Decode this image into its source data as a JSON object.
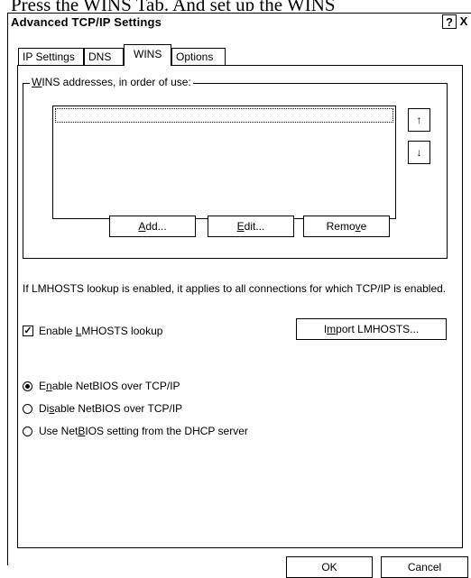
{
  "caption": "Press the WINS Tab. And set up the WINS",
  "dialog": {
    "title": "Advanced TCP/IP Settings",
    "help_label": "?",
    "close_label": "X"
  },
  "tabs": [
    {
      "label": "IP Settings",
      "active": false
    },
    {
      "label": "DNS",
      "active": false
    },
    {
      "label": "WINS",
      "active": true
    },
    {
      "label": "Options",
      "active": false
    }
  ],
  "wins": {
    "group_label_mnemonic": "W",
    "group_label_rest": "INS addresses, in order of use:",
    "addresses": [],
    "move_up_label": "↑",
    "move_down_label": "↓",
    "add_label_mnemonic": "A",
    "add_label_rest": "dd...",
    "edit_label_mnemonic": "E",
    "edit_label_rest": "dit...",
    "remove_label_pre": "Remo",
    "remove_label_mnemonic": "v",
    "remove_label_post": "e"
  },
  "lmhosts": {
    "info": "If LMHOSTS lookup is enabled, it applies to all connections for which TCP/IP is enabled.",
    "checkbox_pre": "Enable ",
    "checkbox_mnemonic": "L",
    "checkbox_post": "MHOSTS lookup",
    "checked": true,
    "import_pre": "I",
    "import_mnemonic": "m",
    "import_post": "port LMHOSTS..."
  },
  "netbios": {
    "options": [
      {
        "pre": "E",
        "mnemonic": "n",
        "post": "able NetBIOS over TCP/IP",
        "selected": true
      },
      {
        "pre": "Di",
        "mnemonic": "s",
        "post": "able NetBIOS over TCP/IP",
        "selected": false
      },
      {
        "pre": "Use Net",
        "mnemonic": "B",
        "post": "IOS setting from the DHCP server",
        "selected": false
      }
    ]
  },
  "footer": {
    "ok_label": "OK",
    "cancel_label": "Cancel"
  }
}
